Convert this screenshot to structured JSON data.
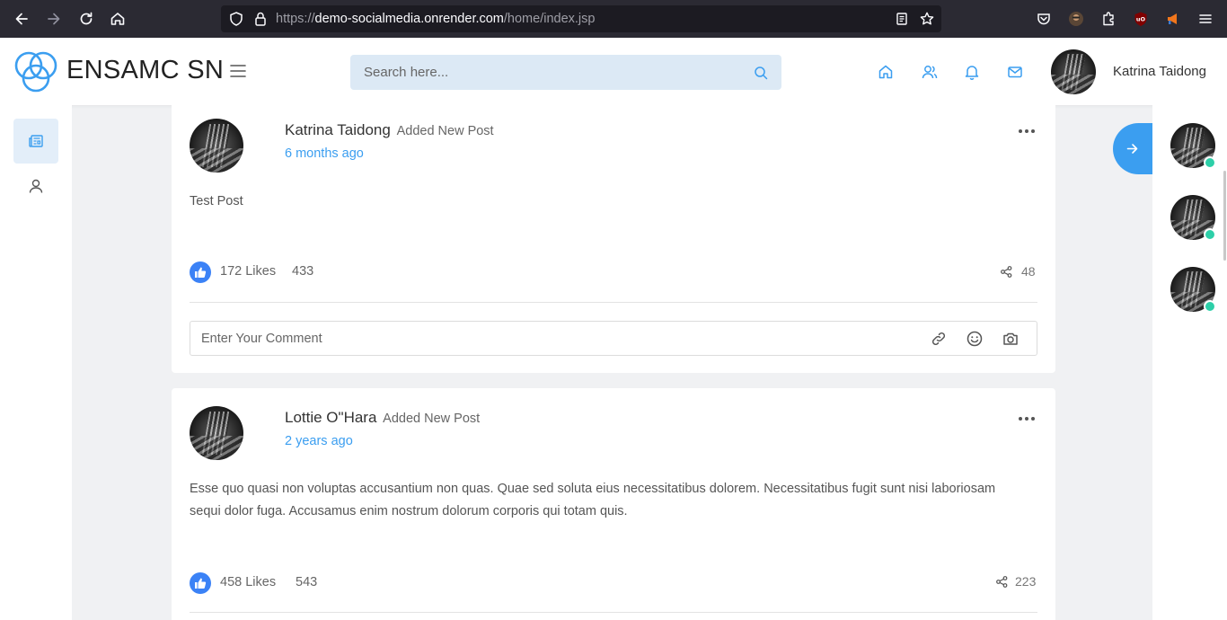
{
  "browser": {
    "url_prefix": "https://",
    "url_host": "demo-socialmedia.onrender.com",
    "url_path": "/home/index.jsp"
  },
  "header": {
    "brand": "ENSAMC SN",
    "search_placeholder": "Search here...",
    "username": "Katrina Taidong"
  },
  "posts": [
    {
      "author": "Katrina Taidong",
      "action": "Added New Post",
      "time": "6 months ago",
      "text": "Test Post",
      "likes": "172 Likes",
      "comments": "433",
      "shares": "48",
      "comment_placeholder": "Enter Your Comment"
    },
    {
      "author": "Lottie O\"Hara",
      "action": "Added New Post",
      "time": "2 years ago",
      "text": "Esse quo quasi non voluptas accusantium non quas. Quae sed soluta eius necessitatibus dolorem. Necessitatibus fugit sunt nisi laboriosam sequi dolor fuga. Accusamus enim nostrum dolorum corporis qui totam quis.",
      "likes": "458 Likes",
      "comments": "543",
      "shares": "223"
    }
  ],
  "colors": {
    "accent": "#3b9ef0",
    "like": "#3b82f6",
    "online": "#2dcfa8",
    "search_bg": "#dce9f5"
  }
}
